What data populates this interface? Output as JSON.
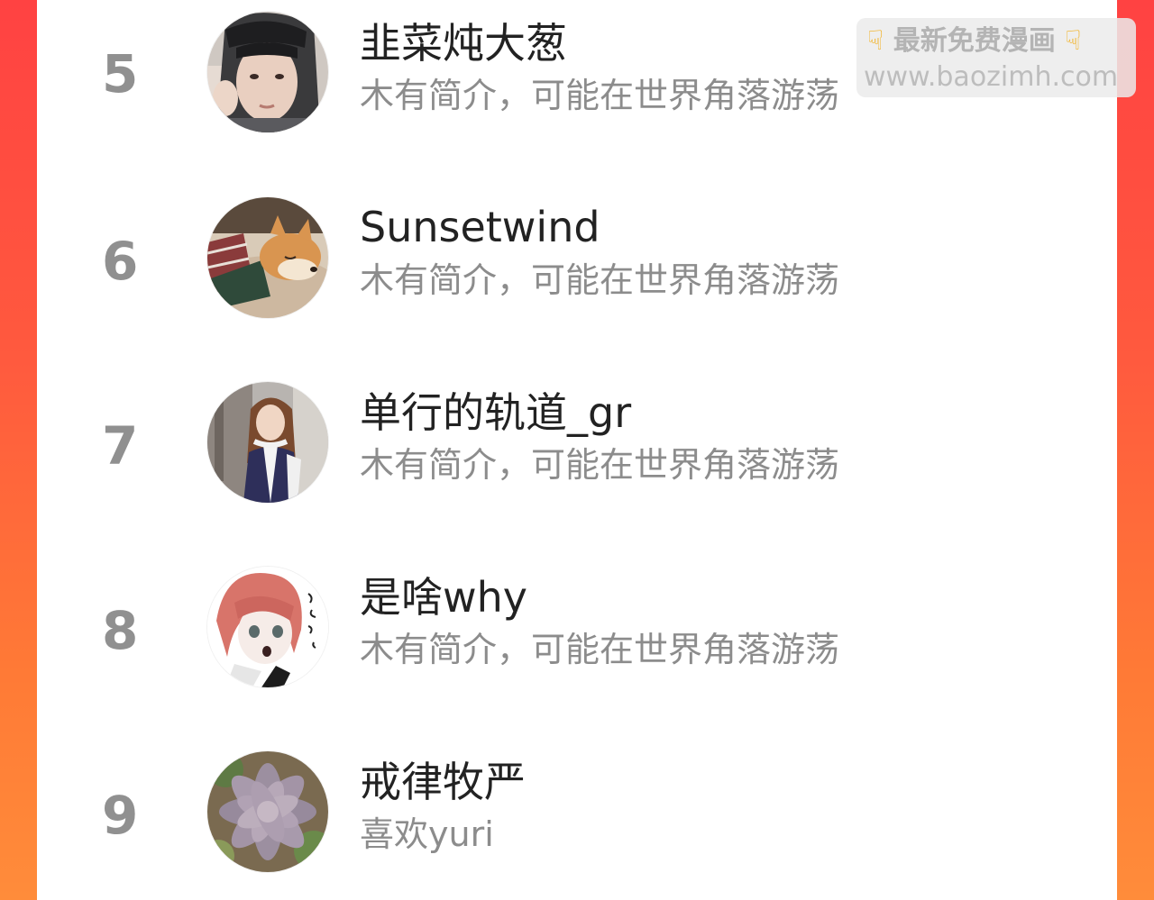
{
  "leaderboard": {
    "rows": [
      {
        "rank": "5",
        "name": "韭菜炖大葱",
        "desc": "木有简介，可能在世界角落游荡",
        "avatar": "avatar-hooded-person"
      },
      {
        "rank": "6",
        "name": "Sunsetwind",
        "desc": "木有简介，可能在世界角落游荡",
        "avatar": "avatar-sleeping-shiba-dog"
      },
      {
        "rank": "7",
        "name": "单行的轨道_gr",
        "desc": "木有简介，可能在世界角落游荡",
        "avatar": "avatar-woman-photo"
      },
      {
        "rank": "8",
        "name": "是啥why",
        "desc": "木有简介，可能在世界角落游荡",
        "avatar": "avatar-manga-girl"
      },
      {
        "rank": "9",
        "name": "戒律牧严",
        "desc": "喜欢yuri",
        "avatar": "avatar-succulent-plant"
      }
    ]
  },
  "watermark": {
    "line1": "最新免费漫画",
    "line2": "www.baozimh.com",
    "icon": "pointing-down-hand-icon"
  },
  "colors": {
    "background_gradient_start": "#ff4242",
    "background_gradient_end": "#ff8c3a",
    "rank_text": "#909090",
    "name_text": "#222222",
    "desc_text": "#8c8c8c"
  }
}
